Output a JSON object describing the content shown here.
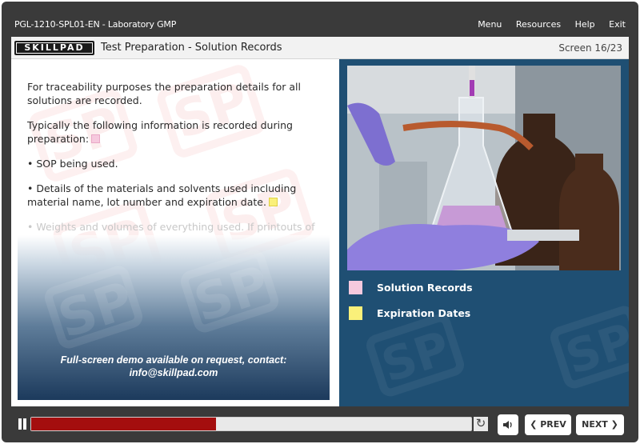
{
  "topbar": {
    "course_title": "PGL-1210-SPL01-EN - Laboratory GMP",
    "nav": {
      "menu": "Menu",
      "resources": "Resources",
      "help": "Help",
      "exit": "Exit"
    }
  },
  "header": {
    "logo": "SKILLPAD",
    "title": "Test Preparation - Solution Records",
    "screen_counter": "Screen 16/23"
  },
  "body": {
    "para1": "For traceability purposes the preparation details for all solutions are recorded.",
    "para2": "Typically the following information is recorded during preparation:",
    "bullet1": "• SOP being used.",
    "bullet2": "• Details of the materials and solvents used including material name, lot number and expiration date.",
    "bullet3_faded": "• Weights and volumes of everything used. If printouts of"
  },
  "demo": {
    "line1": "Full-screen demo available on request, contact:",
    "line2": "info@skillpad.com"
  },
  "legend": {
    "items": [
      {
        "label": "Solution Records",
        "color": "#f6c9de"
      },
      {
        "label": "Expiration Dates",
        "color": "#faf07a"
      }
    ]
  },
  "watermark": {
    "text": "SP"
  },
  "controls": {
    "progress": 0.42,
    "prev_label": "❮ PREV",
    "next_label": "NEXT ❯",
    "replay_icon": "↻",
    "audio_icon": "speaker-icon"
  },
  "colors": {
    "progress_fill": "#a40e0e",
    "right_panel": "#1f4f73",
    "frame": "#3a3a3a"
  }
}
